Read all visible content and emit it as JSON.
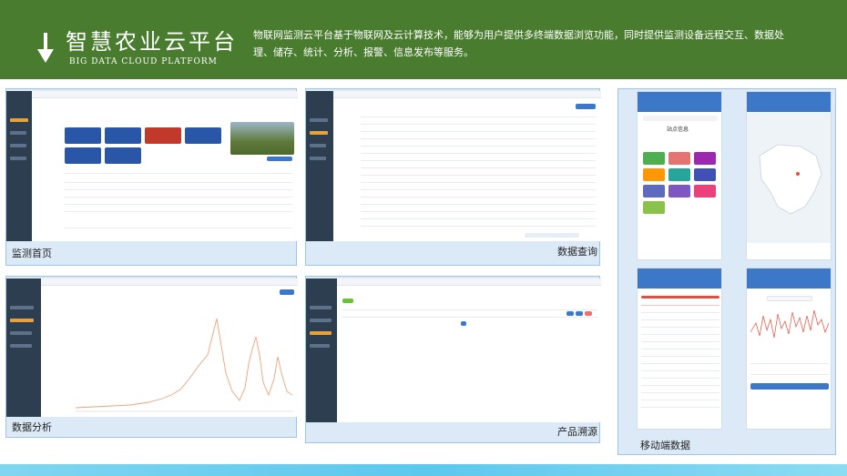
{
  "header": {
    "title": "智慧农业云平台",
    "subtitle": "BIG DATA CLOUD PLATFORM",
    "description": "物联网监测云平台基于物联网及云计算技术，能够为用户提供多终端数据浏览功能，同时提供监测设备远程交互、数据处理、储存、统计、分析、报警、信息发布等服务。"
  },
  "panels": {
    "monitor_home": "监测首页",
    "data_query": "数据查询",
    "data_analysis": "数据分析",
    "product_trace": "产品溯源",
    "mobile_data": "移动端数据"
  },
  "mobile": {
    "site_info": "站点信息"
  },
  "colors": {
    "banner": "#4a7c2f",
    "card_bg": "#dce9f6",
    "card_border": "#9fc4ea",
    "sidebar": "#2c3e50",
    "accent_blue": "#3d78c8",
    "bottom_bar": "#5dc7ee"
  }
}
